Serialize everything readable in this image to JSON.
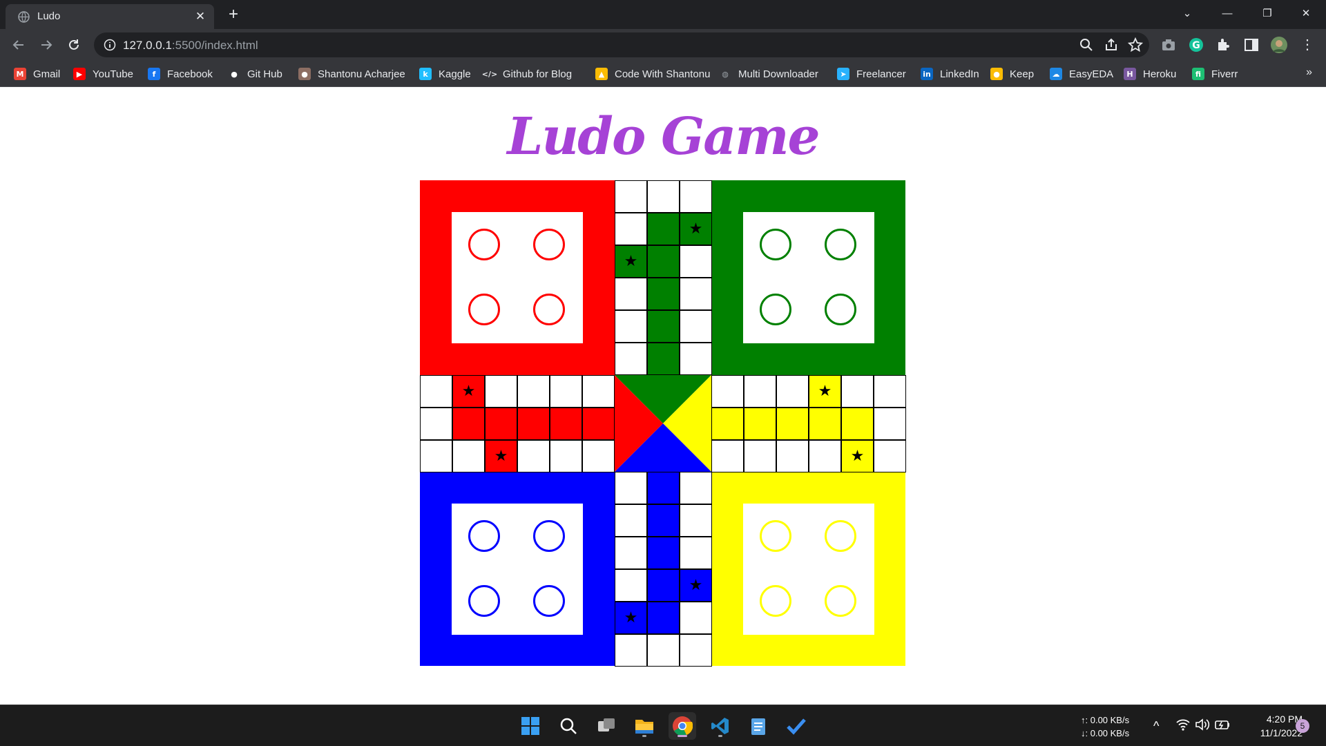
{
  "browser": {
    "tab_title": "Ludo",
    "tab_close": "✕",
    "new_tab": "+",
    "url_host": "127.0.0.1",
    "url_path": ":5500/index.html",
    "minimize": "—",
    "restore": "❐",
    "close": "✕",
    "dropdown": "⌄"
  },
  "bookmarks": [
    {
      "label": "Gmail",
      "icon": "gmail-icon",
      "color": "#ea4335",
      "glyph": "M"
    },
    {
      "label": "YouTube",
      "icon": "youtube-icon",
      "color": "#ff0000",
      "glyph": "▶"
    },
    {
      "label": "Facebook",
      "icon": "facebook-icon",
      "color": "#1877f2",
      "glyph": "f"
    },
    {
      "label": "Git Hub",
      "icon": "github-icon",
      "color": "#ffffff",
      "glyph": "●"
    },
    {
      "label": "Shantonu Acharjee",
      "icon": "avatar-icon",
      "color": "#8d6e63",
      "glyph": "●"
    },
    {
      "label": "Kaggle",
      "icon": "kaggle-icon",
      "color": "#20beff",
      "glyph": "k"
    },
    {
      "label": "Github for Blog",
      "icon": "code-icon",
      "color": "#e8eaed",
      "glyph": "</>"
    },
    {
      "label": "Code With Shantonu",
      "icon": "drive-icon",
      "color": "#fbbc04",
      "glyph": "▲"
    },
    {
      "label": "Multi Downloader",
      "icon": "globe-icon",
      "color": "#9aa0a6",
      "glyph": "◍"
    },
    {
      "label": "Freelancer",
      "icon": "freelancer-icon",
      "color": "#29b2fe",
      "glyph": "➤"
    },
    {
      "label": "LinkedIn",
      "icon": "linkedin-icon",
      "color": "#0a66c2",
      "glyph": "in"
    },
    {
      "label": "Keep",
      "icon": "keep-icon",
      "color": "#fbbc04",
      "glyph": "●"
    },
    {
      "label": "EasyEDA",
      "icon": "easyeda-icon",
      "color": "#1e88e5",
      "glyph": "☁"
    },
    {
      "label": "Heroku",
      "icon": "heroku-icon",
      "color": "#79589f",
      "glyph": "H"
    },
    {
      "label": "Fiverr",
      "icon": "fiverr-icon",
      "color": "#1dbf73",
      "glyph": "fi"
    }
  ],
  "bookmarks_more": "»",
  "page": {
    "title": "Ludo Game"
  },
  "board": {
    "colors": {
      "red": "#ff0000",
      "green": "#008000",
      "yellow": "#ffff00",
      "blue": "#0000ff"
    },
    "star": "★"
  },
  "taskbar": {
    "upload": "↑: 0.00 KB/s",
    "download": "↓: 0.00 KB/s",
    "time": "4:20 PM",
    "date": "11/1/2022",
    "notifications": "5",
    "tray_chevron": "^"
  }
}
